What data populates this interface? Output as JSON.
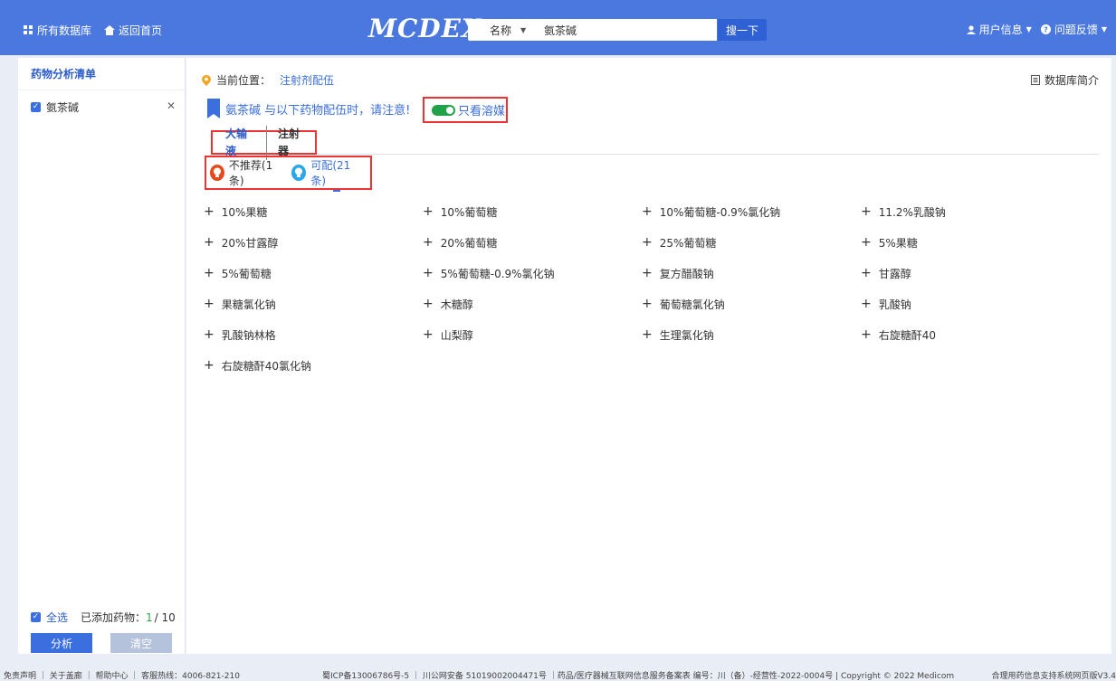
{
  "header": {
    "all_db": "所有数据库",
    "home": "返回首页",
    "logo": "MCDEX",
    "search_type": "名称",
    "search_value": "氨茶碱",
    "search_btn": "搜一下",
    "user_info": "用户信息",
    "feedback": "问题反馈"
  },
  "sidebar": {
    "title": "药物分析清单",
    "drug": "氨茶碱",
    "select_all": "全选",
    "added_label": "已添加药物：",
    "added_count": "1",
    "added_total": "/ 10",
    "analyze": "分析",
    "clear": "清空"
  },
  "main": {
    "location_label": "当前位置：",
    "location_value": "注射剂配伍",
    "db_intro": "数据库简介",
    "notice": "氨茶碱 与以下药物配伍时，请注意!",
    "toggle_label": "只看溶媒",
    "toggle_on": true,
    "tabs": [
      "大输液",
      "注射器"
    ],
    "filters": {
      "not_recommended": "不推荐(1条)",
      "compatible": "可配(21条)"
    },
    "items": [
      "10%果糖",
      "10%葡萄糖",
      "10%葡萄糖-0.9%氯化钠",
      "11.2%乳酸钠",
      "20%甘露醇",
      "20%葡萄糖",
      "25%葡萄糖",
      "5%果糖",
      "5%葡萄糖",
      "5%葡萄糖-0.9%氯化钠",
      "复方醋酸钠",
      "甘露醇",
      "果糖氯化钠",
      "木糖醇",
      "葡萄糖氯化钠",
      "乳酸钠",
      "乳酸钠林格",
      "山梨醇",
      "生理氯化钠",
      "右旋糖酐40",
      "右旋糖酐40氯化钠"
    ]
  },
  "footer": {
    "left": "免责声明 ｜ 关于盖廊 ｜ 帮助中心 ｜ 客服热线：4006-821-210",
    "middle": "蜀ICP备13006786号-5 ｜ 川公网安备 51019002004471号 ｜药品/医疗器械互联网信息服务备案表 编号：川（备）-经营性-2022-0004号 | Copyright © 2022 Medicom",
    "right": "合理用药信息支持系统网页版V3.4"
  },
  "colors": {
    "topbar": "#4a78de",
    "accent": "#3b6fe0",
    "highlight_border": "#ee3333",
    "toggle_on": "#21a148",
    "not_recommended": "#e34b1a",
    "compatible": "#2aa7e8"
  }
}
